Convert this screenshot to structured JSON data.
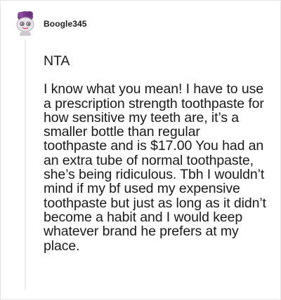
{
  "comment": {
    "author": "Boogle345",
    "avatar_icon": "snoo-avatar-icon",
    "paragraphs": [
      "NTA",
      "I know what you mean! I have to use a prescription strength toothpaste for how sensitive my teeth are, it’s a smaller bottle than regular toothpaste and is $17.00 You had an an extra tube of normal toothpaste, she’s being ridiculous. Tbh I wouldn’t mind if my bf used my expensive toothpaste but just as long as it didn’t become a habit and I would keep whatever brand he prefers at my place."
    ]
  },
  "colors": {
    "avatar_hair": "#7b3f8c",
    "avatar_face": "#e9e3ea",
    "thread_line": "#ececec"
  }
}
